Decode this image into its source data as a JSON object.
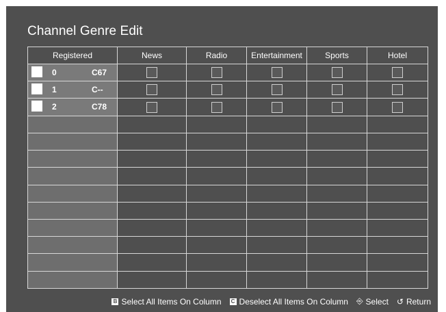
{
  "title": "Channel Genre Edit",
  "columns": [
    "Registered",
    "News",
    "Radio",
    "Entertainment",
    "Sports",
    "Hotel"
  ],
  "rows": [
    {
      "number": "0",
      "name": "C67"
    },
    {
      "number": "1",
      "name": "C--"
    },
    {
      "number": "2",
      "name": "C78"
    }
  ],
  "footer": {
    "b_key": "B",
    "select_all": "Select All Items On Column",
    "c_key": "C",
    "deselect_all": "Deselect All Items On Column",
    "select": "Select",
    "return": "Return"
  },
  "colors": {
    "panel": "#4f4f4f",
    "registered_column": "#6e6e6e",
    "text": "#ffffff"
  }
}
